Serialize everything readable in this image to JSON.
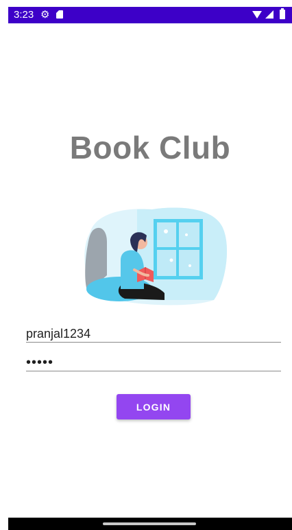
{
  "status_bar": {
    "time": "3:23",
    "background": "#3d00c8",
    "icons": [
      "gear-icon",
      "sd-card-icon",
      "wifi-icon",
      "signal-icon",
      "battery-icon"
    ]
  },
  "app": {
    "title": "Book Club",
    "title_color": "#7a7a7a"
  },
  "login_form": {
    "username_value": "pranjal1234",
    "password_value": "•••••",
    "login_label": "LOGIN",
    "button_color": "#9346f0"
  },
  "illustration": {
    "subject": "person-reading-book-icon"
  }
}
